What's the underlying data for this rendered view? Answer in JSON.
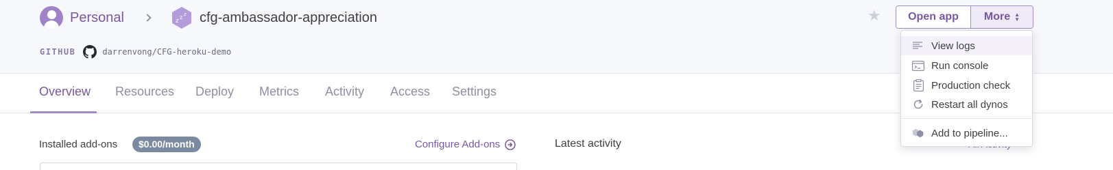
{
  "breadcrumb": {
    "owner": "Personal",
    "app_name": "cfg-ambassador-appreciation"
  },
  "github": {
    "label": "GITHUB",
    "repo": "darrenvong/CFG-heroku-demo"
  },
  "header_actions": {
    "star_icon": "star-icon",
    "open_app_label": "Open app",
    "more_label": "More"
  },
  "tabs": [
    {
      "label": "Overview",
      "active": true
    },
    {
      "label": "Resources",
      "active": false
    },
    {
      "label": "Deploy",
      "active": false
    },
    {
      "label": "Metrics",
      "active": false
    },
    {
      "label": "Activity",
      "active": false
    },
    {
      "label": "Access",
      "active": false
    },
    {
      "label": "Settings",
      "active": false
    }
  ],
  "more_menu": {
    "items": [
      {
        "label": "View logs",
        "icon": "logs-icon",
        "highlighted": true
      },
      {
        "label": "Run console",
        "icon": "console-icon",
        "highlighted": false
      },
      {
        "label": "Production check",
        "icon": "clipboard-icon",
        "highlighted": false
      },
      {
        "label": "Restart all dynos",
        "icon": "restart-icon",
        "highlighted": false
      },
      {
        "label": "Add to pipeline...",
        "icon": "pipeline-icon",
        "highlighted": false
      }
    ]
  },
  "addons": {
    "label": "Installed add-ons",
    "price": "$0.00/month",
    "configure_label": "Configure Add-ons"
  },
  "activity": {
    "label": "Latest activity",
    "all_label": "All Activity"
  },
  "colors": {
    "brand_purple": "#79589f",
    "header_bg": "#f7f8fb",
    "pill_bg": "#7b8aa0"
  }
}
